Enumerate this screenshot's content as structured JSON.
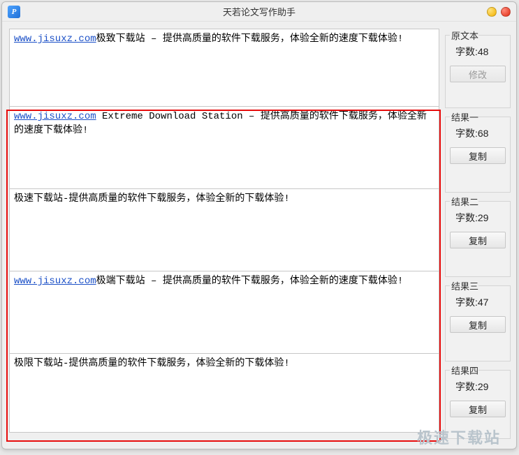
{
  "window": {
    "title": "天若论文写作助手",
    "icon_letter": "P"
  },
  "panes": [
    {
      "link": "www.jisuxz.com",
      "link_mono": false,
      "text_after": "极致下载站 – 提供高质量的软件下载服务，体验全新的速度下载体验!"
    },
    {
      "link": "www.jisuxz.com",
      "link_mono": true,
      "text_after": " Extreme Download Station  – 提供高质量的软件下载服务，体验全新的速度下载体验!"
    },
    {
      "link": "",
      "link_mono": false,
      "text_after": "极速下载站-提供高质量的软件下载服务，体验全新的下载体验!"
    },
    {
      "link": "www.jisuxz.com",
      "link_mono": true,
      "text_after": "极端下载站 – 提供高质量的软件下载服务，体验全新的速度下载体验!"
    },
    {
      "link": "",
      "link_mono": false,
      "text_after": "极限下载站-提供高质量的软件下载服务，体验全新的下载体验!"
    }
  ],
  "groups": [
    {
      "title": "原文本",
      "count_label": "字数:48",
      "button": "修改",
      "disabled": true
    },
    {
      "title": "结果一",
      "count_label": "字数:68",
      "button": "复制",
      "disabled": false
    },
    {
      "title": "结果二",
      "count_label": "字数:29",
      "button": "复制",
      "disabled": false
    },
    {
      "title": "结果三",
      "count_label": "字数:47",
      "button": "复制",
      "disabled": false
    },
    {
      "title": "结果四",
      "count_label": "字数:29",
      "button": "复制",
      "disabled": false
    }
  ],
  "watermark": "极速下载站"
}
